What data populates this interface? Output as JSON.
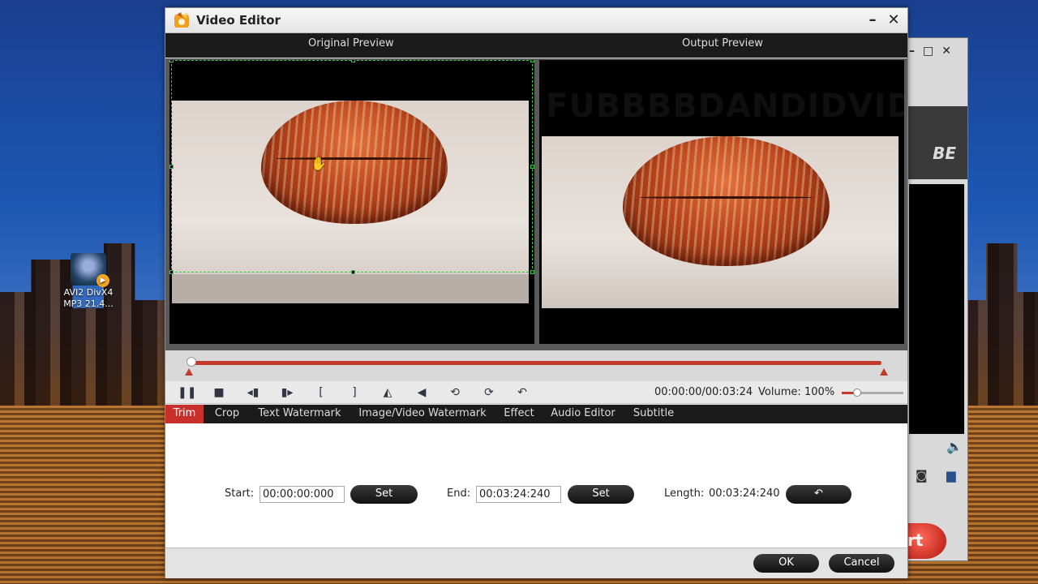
{
  "desktop": {
    "icon_label": "AVI2 DivX4 MP3 21.4..."
  },
  "background_app": {
    "logo_text": "BE",
    "convert_text": "rt"
  },
  "window": {
    "title": "Video Editor"
  },
  "preview": {
    "original_label": "Original Preview",
    "output_label": "Output Preview",
    "output_overlay_text": "FUBBBBDANDIDVIDEO",
    "output_overlay_char": "O"
  },
  "timeline": {
    "position_fraction": 0.0
  },
  "playback": {
    "timecode": "00:00:00/00:03:24",
    "volume_label": "Volume:",
    "volume_value": "100%",
    "volume_fraction": 0.25
  },
  "tabs": [
    {
      "label": "Trim",
      "active": true
    },
    {
      "label": "Crop",
      "active": false
    },
    {
      "label": "Text Watermark",
      "active": false
    },
    {
      "label": "Image/Video Watermark",
      "active": false
    },
    {
      "label": "Effect",
      "active": false
    },
    {
      "label": "Audio Editor",
      "active": false
    },
    {
      "label": "Subtitle",
      "active": false
    }
  ],
  "trim": {
    "start_label": "Start:",
    "start_value": "00:00:00:000",
    "start_set": "Set",
    "end_label": "End:",
    "end_value": "00:03:24:240",
    "end_set": "Set",
    "length_label": "Length:",
    "length_value": "00:03:24:240",
    "reset_icon": "undo-icon"
  },
  "footer": {
    "ok": "OK",
    "cancel": "Cancel"
  },
  "colors": {
    "accent_red": "#c9302c",
    "crop_green": "#2ecc40"
  },
  "icons": [
    "pause-icon",
    "stop-icon",
    "prev-frame-icon",
    "next-frame-icon",
    "mark-in-icon",
    "mark-out-icon",
    "flip-horizontal-icon",
    "flip-vertical-icon",
    "rotate-left-icon",
    "rotate-right-icon",
    "reset-icon"
  ]
}
